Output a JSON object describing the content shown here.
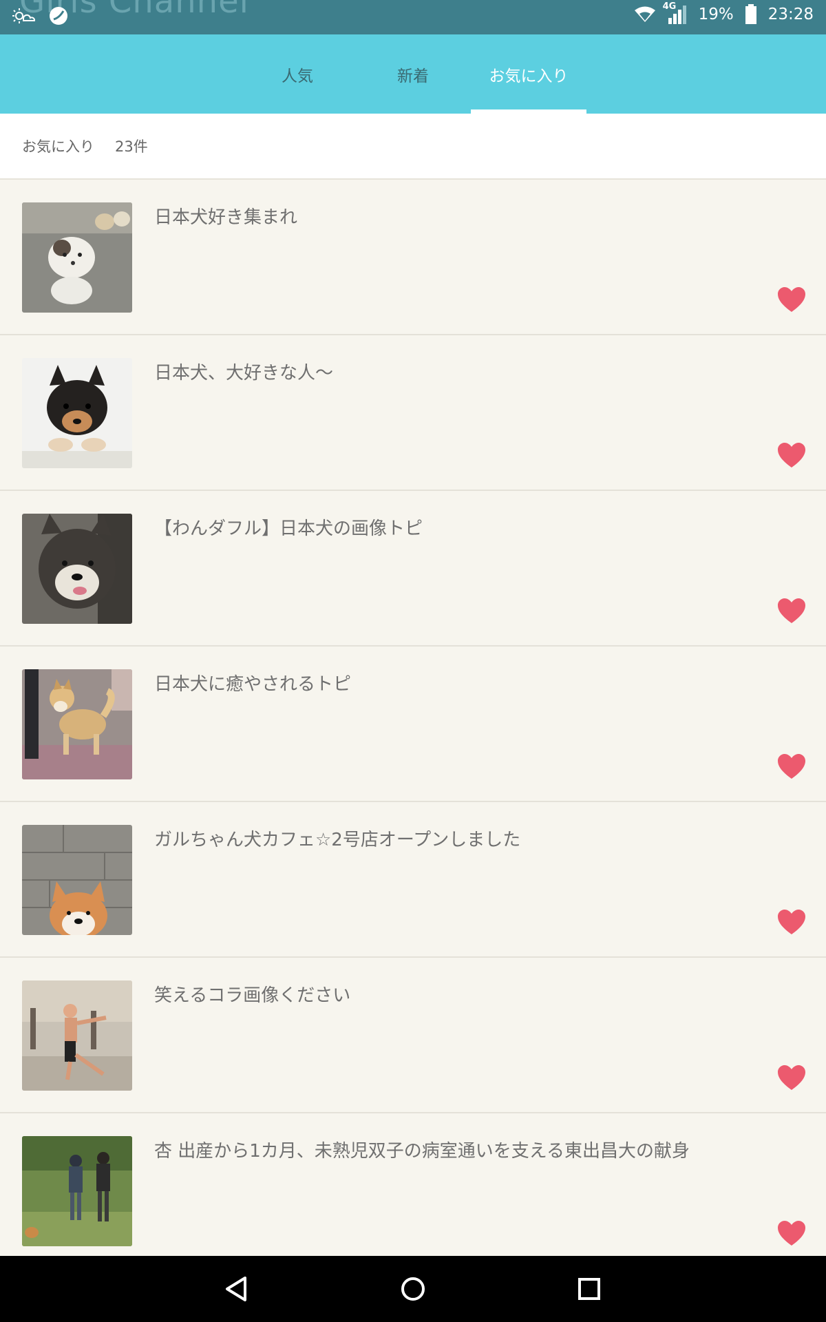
{
  "status_bar": {
    "ghost_title": "Girls Channel",
    "battery": "19%",
    "time": "23:28",
    "network": "4G",
    "icons": [
      "weather-icon",
      "app-notification-icon",
      "wifi-icon",
      "signal-icon",
      "battery-icon"
    ]
  },
  "tabs": [
    {
      "label": "人気",
      "active": false
    },
    {
      "label": "新着",
      "active": false
    },
    {
      "label": "お気に入り",
      "active": true
    }
  ],
  "favorites_header": {
    "label": "お気に入り",
    "count": "23件"
  },
  "items": [
    {
      "title": "日本犬好き集まれ",
      "thumb": "white-puppy"
    },
    {
      "title": "日本犬、大好きな人〜",
      "thumb": "black-puppy"
    },
    {
      "title": "【わんダフル】日本犬の画像トピ",
      "thumb": "shiba-tongue"
    },
    {
      "title": "日本犬に癒やされるトピ",
      "thumb": "akita-dog"
    },
    {
      "title": "ガルちゃん犬カフェ☆2号店オープンしました",
      "thumb": "shiba-wall"
    },
    {
      "title": "笑えるコラ画像ください",
      "thumb": "dance-collage"
    },
    {
      "title": "杏 出産から1カ月、未熟児双子の病室通いを支える東出昌大の献身",
      "thumb": "couple-grass"
    }
  ],
  "colors": {
    "status_bar": "#3e7f8c",
    "tab_bar": "#5ccfe0",
    "heart": "#ec5a6e",
    "background": "#f7f5ee"
  },
  "nav": [
    "back-icon",
    "home-icon",
    "recents-icon"
  ]
}
